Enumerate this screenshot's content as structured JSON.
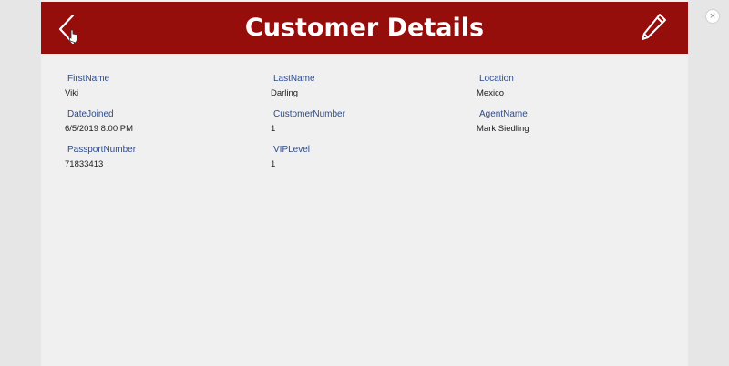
{
  "header": {
    "title": "Customer Details",
    "background_color": "#950e0c",
    "back_icon": "chevron-left-icon",
    "edit_icon": "pencil-icon"
  },
  "fields": [
    {
      "label": "FirstName",
      "value": "Viki"
    },
    {
      "label": "LastName",
      "value": "Darling"
    },
    {
      "label": "Location",
      "value": "Mexico"
    },
    {
      "label": "DateJoined",
      "value": "6/5/2019 8:00 PM"
    },
    {
      "label": "CustomerNumber",
      "value": "1"
    },
    {
      "label": "AgentName",
      "value": "Mark Siedling"
    },
    {
      "label": "PassportNumber",
      "value": "71833413"
    },
    {
      "label": "VIPLevel",
      "value": "1"
    }
  ],
  "close_button": {
    "glyph": "×"
  }
}
